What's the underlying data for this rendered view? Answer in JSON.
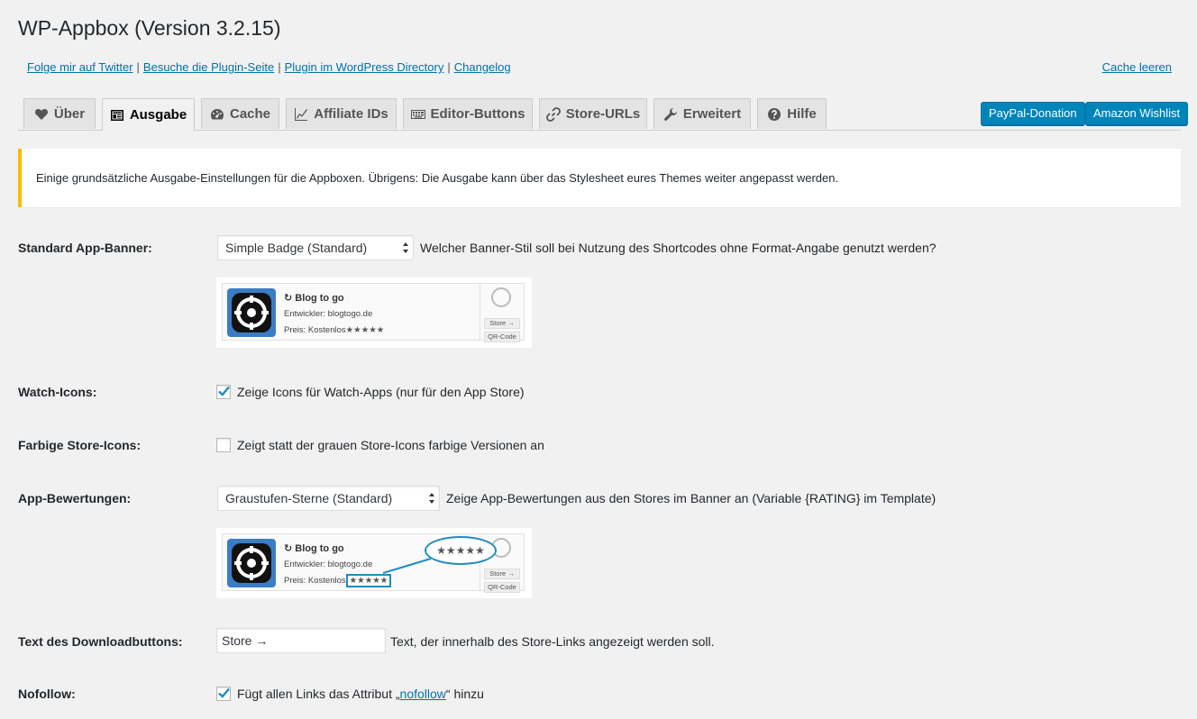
{
  "title": "WP-Appbox (Version 3.2.15)",
  "links": {
    "twitter": "Folge mir auf Twitter",
    "plugin_site": "Besuche die Plugin-Seite",
    "directory": "Plugin im WordPress Directory",
    "changelog": "Changelog",
    "cache_clear": "Cache leeren"
  },
  "tabs": [
    {
      "label": "Über",
      "icon": "heart-icon"
    },
    {
      "label": "Ausgabe",
      "icon": "layout-icon",
      "active": true
    },
    {
      "label": "Cache",
      "icon": "dashboard-icon"
    },
    {
      "label": "Affiliate IDs",
      "icon": "chart-icon"
    },
    {
      "label": "Editor-Buttons",
      "icon": "keyboard-icon"
    },
    {
      "label": "Store-URLs",
      "icon": "link-icon"
    },
    {
      "label": "Erweitert",
      "icon": "wrench-icon"
    },
    {
      "label": "Hilfe",
      "icon": "help-icon"
    }
  ],
  "buttons": {
    "paypal": "PayPal-Donation",
    "amazon": "Amazon Wishlist"
  },
  "notice": "Einige grundsätzliche Ausgabe-Einstellungen für die Appboxen. Übrigens: Die Ausgabe kann über das Stylesheet eures Themes weiter angepasst werden.",
  "settings": {
    "banner": {
      "label": "Standard App-Banner:",
      "value": "Simple Badge (Standard)",
      "description": "Welcher Banner-Stil soll bei Nutzung des Shortcodes ohne Format-Angabe genutzt werden?"
    },
    "watch_icons": {
      "label": "Watch-Icons:",
      "checked": true,
      "description": "Zeige Icons für Watch-Apps (nur für den App Store)"
    },
    "colored_icons": {
      "label": "Farbige Store-Icons:",
      "checked": false,
      "description": "Zeigt statt der grauen Store-Icons farbige Versionen an"
    },
    "ratings": {
      "label": "App-Bewertungen:",
      "value": "Graustufen-Sterne (Standard)",
      "description": "Zeige App-Bewertungen aus den Stores im Banner an (Variable {RATING} im Template)"
    },
    "download_text": {
      "label": "Text des Downloadbuttons:",
      "value": "Store →",
      "description": "Text, der innerhalb des Store-Links angezeigt werden soll."
    },
    "nofollow": {
      "label": "Nofollow:",
      "checked": true,
      "description_prefix": "Fügt allen Links das Attribut „",
      "description_link": "nofollow",
      "description_suffix": "“ hinzu"
    }
  },
  "banner_preview": {
    "app_name": "↻ Blog to go",
    "developer": "Entwickler: blogtogo.de",
    "price": "Preis: Kostenlos",
    "stars": "★★★★★",
    "store_btn": "Store →",
    "qr_btn": "QR-Code",
    "big_stars": "★★★★★"
  },
  "colors": {
    "accent": "#0073aa",
    "button": "#0085ba",
    "notice_border": "#ffb900"
  }
}
